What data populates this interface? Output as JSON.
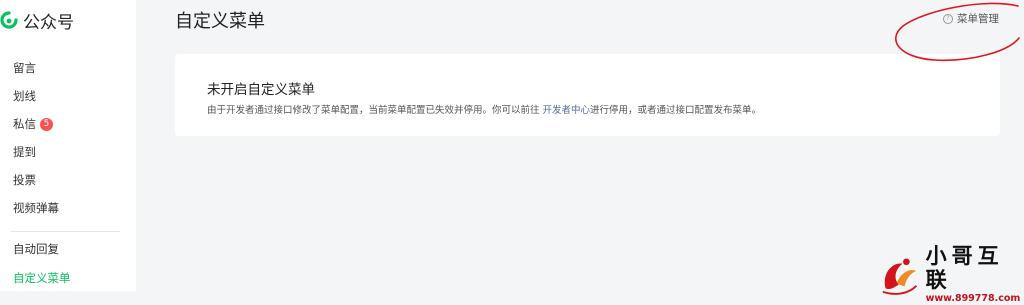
{
  "sidebar": {
    "app_name": "公众号",
    "items": [
      {
        "label": "留言"
      },
      {
        "label": "划线"
      },
      {
        "label": "私信",
        "badge": "5"
      },
      {
        "label": "提到"
      },
      {
        "label": "投票"
      },
      {
        "label": "视频弹幕"
      },
      {
        "label": "自动回复"
      },
      {
        "label": "自定义菜单",
        "active": true
      }
    ]
  },
  "header": {
    "title": "自定义菜单",
    "help_label": "菜单管理"
  },
  "notice": {
    "title": "未开启自定义菜单",
    "desc_before": "由于开发者通过接口修改了菜单配置，当前菜单配置已失效并停用。你可以前往 ",
    "link_text": "开发者中心",
    "desc_after": "进行停用，或者通过接口配置发布菜单。"
  },
  "watermark": {
    "name": "小哥互联",
    "url": "www.899778.com"
  },
  "colors": {
    "accent": "#07c160",
    "badge": "#fa5151",
    "link": "#576b95",
    "annotation": "#e0141e"
  }
}
